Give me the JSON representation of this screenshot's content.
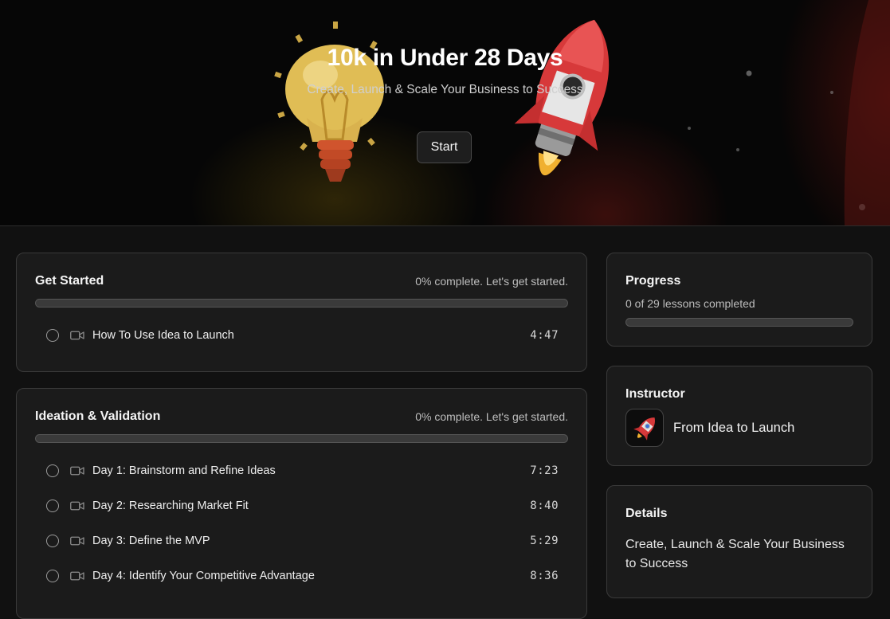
{
  "hero": {
    "title": "10k in Under 28 Days",
    "subtitle": "Create, Launch & Scale Your Business to Success",
    "start_label": "Start"
  },
  "modules": [
    {
      "title": "Get Started",
      "status": "0% complete. Let's get started.",
      "progress_percent": 0,
      "lessons": [
        {
          "title": "How To Use Idea to Launch",
          "duration": "4:47",
          "completed": false
        }
      ]
    },
    {
      "title": "Ideation & Validation",
      "status": "0% complete. Let's get started.",
      "progress_percent": 0,
      "lessons": [
        {
          "title": "Day 1: Brainstorm and Refine Ideas",
          "duration": "7:23",
          "completed": false
        },
        {
          "title": "Day 2: Researching Market Fit",
          "duration": "8:40",
          "completed": false
        },
        {
          "title": "Day 3: Define the MVP",
          "duration": "5:29",
          "completed": false
        },
        {
          "title": "Day 4: Identify Your Competitive Advantage",
          "duration": "8:36",
          "completed": false
        }
      ]
    }
  ],
  "progress": {
    "title": "Progress",
    "summary": "0 of 29 lessons completed",
    "percent": 0
  },
  "instructor": {
    "title": "Instructor",
    "name": "From Idea to Launch",
    "avatar_icon": "rocket-icon"
  },
  "details": {
    "title": "Details",
    "text": "Create, Launch & Scale Your Business to Success"
  },
  "colors": {
    "background": "#111111",
    "card": "#1b1b1b",
    "card_border": "#3a3a3a",
    "track": "#3a3a3a",
    "rocket_red": "#d7393a",
    "bulb_yellow": "#e8c45a"
  },
  "icons": {
    "lesson_status": "circle-icon",
    "lesson_type": "video-camera-icon"
  }
}
